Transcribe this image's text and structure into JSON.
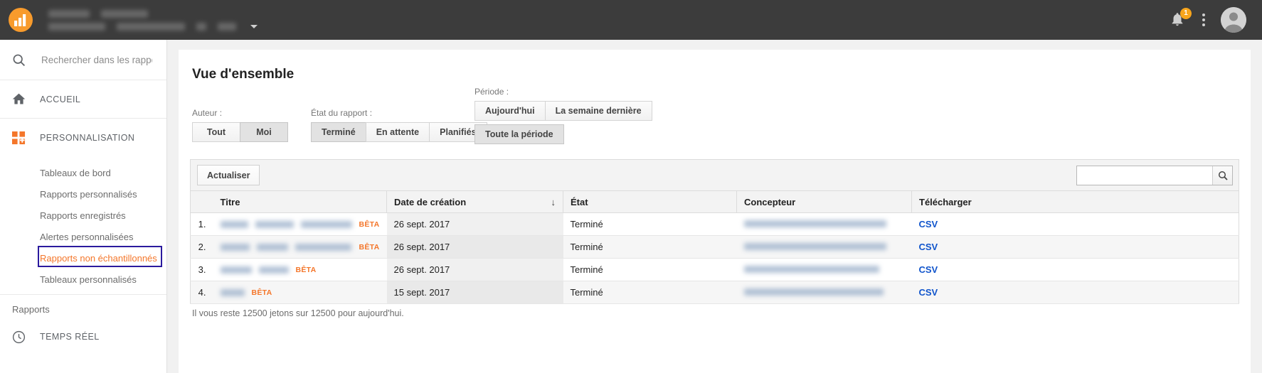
{
  "topbar": {
    "logo_icon": "google-analytics-logo",
    "notifications_icon": "bell-icon",
    "notification_count": "1",
    "more_icon": "kebab-menu-icon",
    "avatar_icon": "user-avatar-icon"
  },
  "sidebar": {
    "search_placeholder": "Rechercher dans les rappor",
    "search_icon": "search-icon",
    "items": [
      {
        "label": "ACCUEIL",
        "icon": "home-icon"
      },
      {
        "label": "PERSONNALISATION",
        "icon": "customization-icon"
      }
    ],
    "sub_items": [
      {
        "label": "Tableaux de bord",
        "active": false
      },
      {
        "label": "Rapports personnalisés",
        "active": false
      },
      {
        "label": "Rapports enregistrés",
        "active": false
      },
      {
        "label": "Alertes personnalisées",
        "active": false
      },
      {
        "label": "Rapports non échantillonnés",
        "active": true
      },
      {
        "label": "Tableaux personnalisés",
        "active": false
      }
    ],
    "section_label": "Rapports",
    "realtime": {
      "label": "TEMPS RÉEL",
      "icon": "clock-icon"
    },
    "highlight_color": "#2b1a9e",
    "active_color": "#f4762a"
  },
  "main": {
    "title": "Vue d'ensemble",
    "filters": {
      "auteur": {
        "label": "Auteur :",
        "options": [
          {
            "label": "Tout",
            "selected": false
          },
          {
            "label": "Moi",
            "selected": true
          }
        ]
      },
      "etat": {
        "label": "État du rapport :",
        "options": [
          {
            "label": "Terminé",
            "selected": true
          },
          {
            "label": "En attente",
            "selected": false
          },
          {
            "label": "Planifiés",
            "selected": false
          }
        ]
      },
      "periode": {
        "label": "Période :",
        "row1": [
          {
            "label": "Aujourd'hui",
            "selected": false
          },
          {
            "label": "La semaine dernière",
            "selected": false
          }
        ],
        "row2": [
          {
            "label": "Toute la période",
            "selected": true
          }
        ]
      }
    },
    "toolbar": {
      "refresh_label": "Actualiser",
      "search_value": "",
      "search_icon": "search-icon"
    },
    "table": {
      "columns": [
        {
          "key": "num",
          "label": ""
        },
        {
          "key": "titre",
          "label": "Titre"
        },
        {
          "key": "date",
          "label": "Date de création",
          "sorted": true,
          "sort_icon": "arrow-down-icon"
        },
        {
          "key": "etat",
          "label": "État"
        },
        {
          "key": "concepteur",
          "label": "Concepteur"
        },
        {
          "key": "telecharger",
          "label": "Télécharger"
        }
      ],
      "rows": [
        {
          "num": "1.",
          "title_redacted": true,
          "title_widths": [
            52,
            72,
            96
          ],
          "badge": "BÊTA",
          "date": "26 sept. 2017",
          "etat": "Terminé",
          "concepteur_redacted": true,
          "download": "CSV"
        },
        {
          "num": "2.",
          "title_redacted": true,
          "title_widths": [
            46,
            48,
            88
          ],
          "badge": "BÊTA",
          "date": "26 sept. 2017",
          "etat": "Terminé",
          "concepteur_redacted": true,
          "download": "CSV"
        },
        {
          "num": "3.",
          "title_redacted": true,
          "title_widths": [
            44,
            42
          ],
          "badge": "BÊTA",
          "date": "26 sept. 2017",
          "etat": "Terminé",
          "concepteur_redacted": true,
          "download": "CSV"
        },
        {
          "num": "4.",
          "title_redacted": true,
          "title_widths": [
            34
          ],
          "badge": "BÊTA",
          "date": "15 sept. 2017",
          "etat": "Terminé",
          "concepteur_redacted": true,
          "download": "CSV"
        }
      ]
    },
    "footnote": "Il vous reste 12500 jetons sur 12500 pour aujourd'hui."
  }
}
